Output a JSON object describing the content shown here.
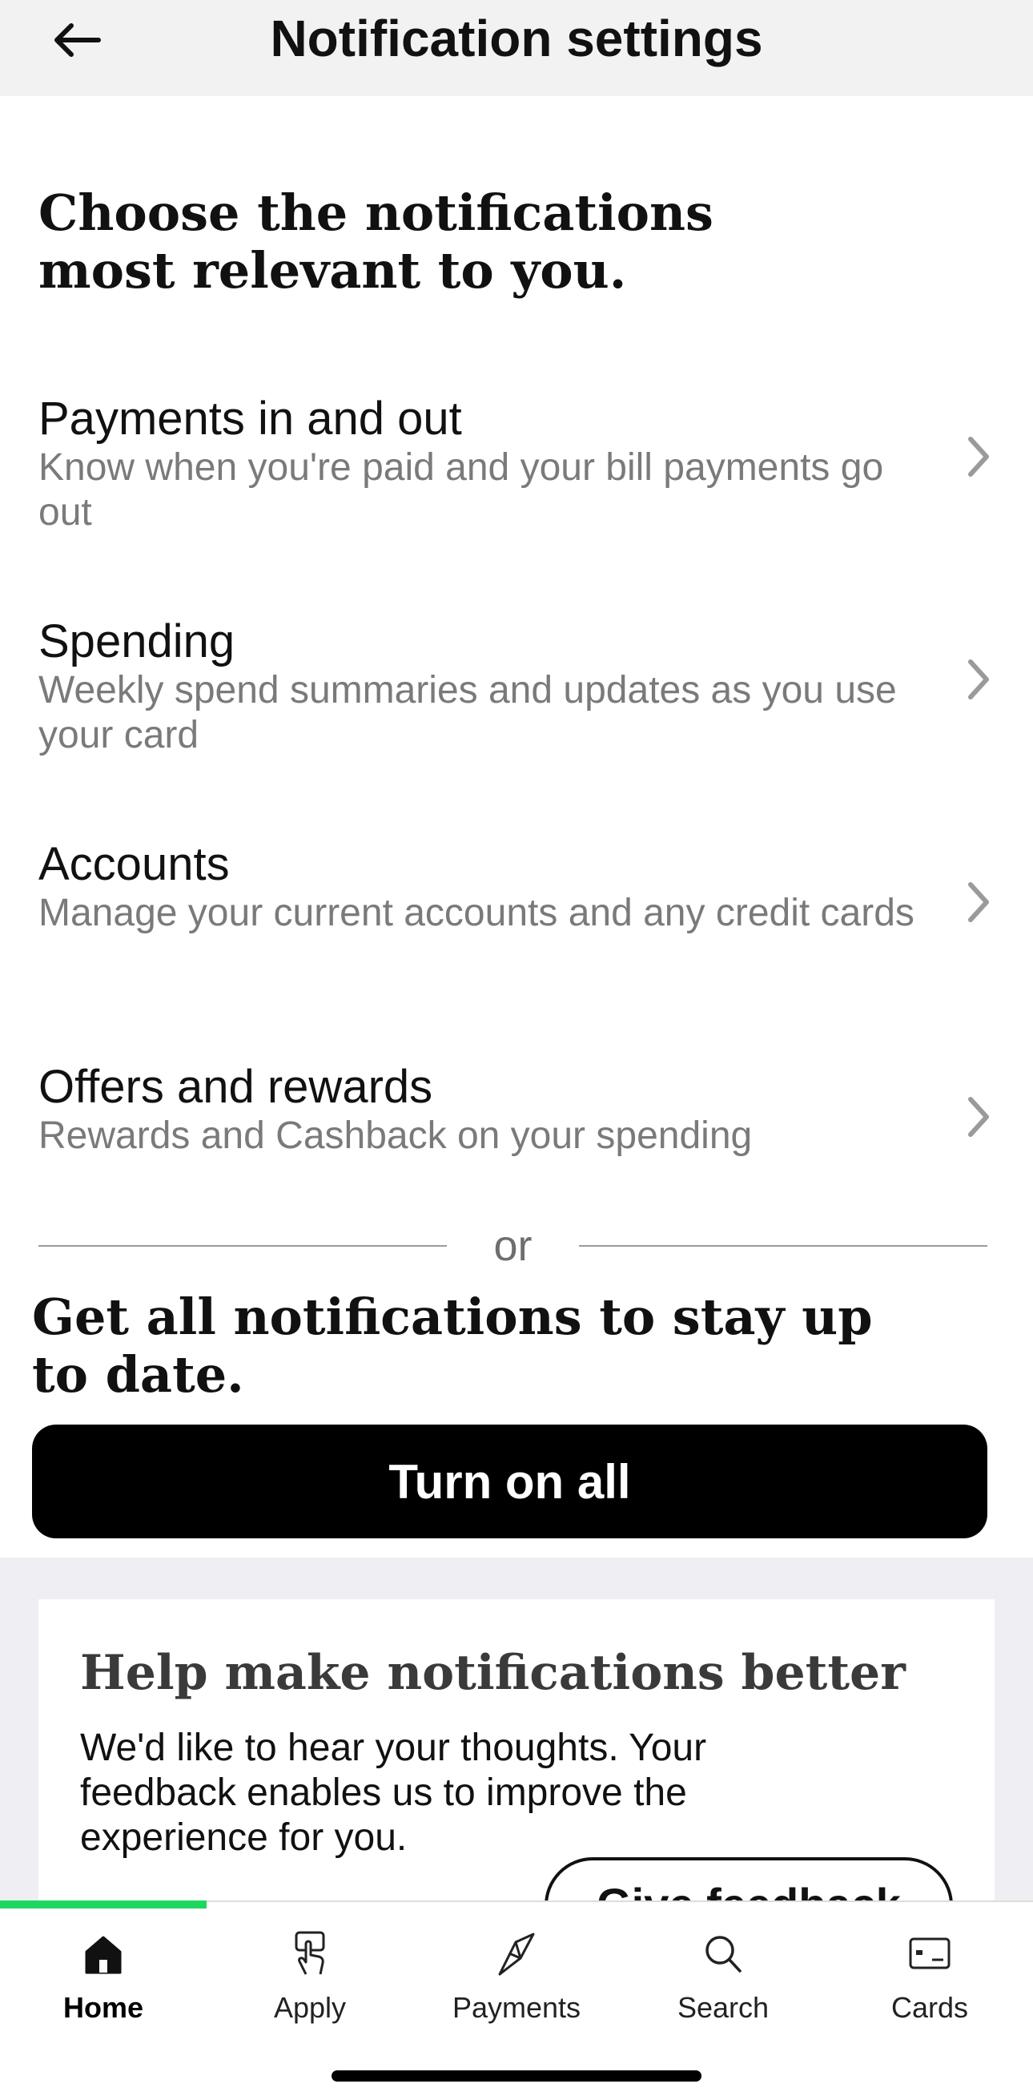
{
  "header": {
    "title": "Notification settings",
    "back_icon": "arrow-left-icon"
  },
  "intro": "Choose the notifications most relevant to you.",
  "categories": [
    {
      "title": "Payments in and out",
      "description": "Know when you're paid and your bill payments go out"
    },
    {
      "title": "Spending",
      "description": "Weekly spend summaries and updates as you use your card"
    },
    {
      "title": "Accounts",
      "description": "Manage your current accounts and any credit cards"
    },
    {
      "title": "Offers and rewards",
      "description": "Rewards and Cashback on your spending"
    }
  ],
  "divider_text": "or",
  "all_heading": "Get all notifications to stay up to date.",
  "turn_on_all_label": "Turn on all",
  "feedback": {
    "title": "Help make notifications better",
    "body": "We'd like to hear your thoughts. Your feedback enables us to improve the experience for you.",
    "button_label": "Give feedback"
  },
  "tabs": [
    {
      "label": "Home",
      "icon": "home-icon",
      "active": true
    },
    {
      "label": "Apply",
      "icon": "tap-hand-icon",
      "active": false
    },
    {
      "label": "Payments",
      "icon": "send-arrows-icon",
      "active": false
    },
    {
      "label": "Search",
      "icon": "search-icon",
      "active": false
    },
    {
      "label": "Cards",
      "icon": "card-icon",
      "active": false
    }
  ],
  "colors": {
    "accent": "#1ed760",
    "header_bg": "#f2f2f2",
    "primary_button": "#000000",
    "secondary_text": "#7a7a7a"
  }
}
